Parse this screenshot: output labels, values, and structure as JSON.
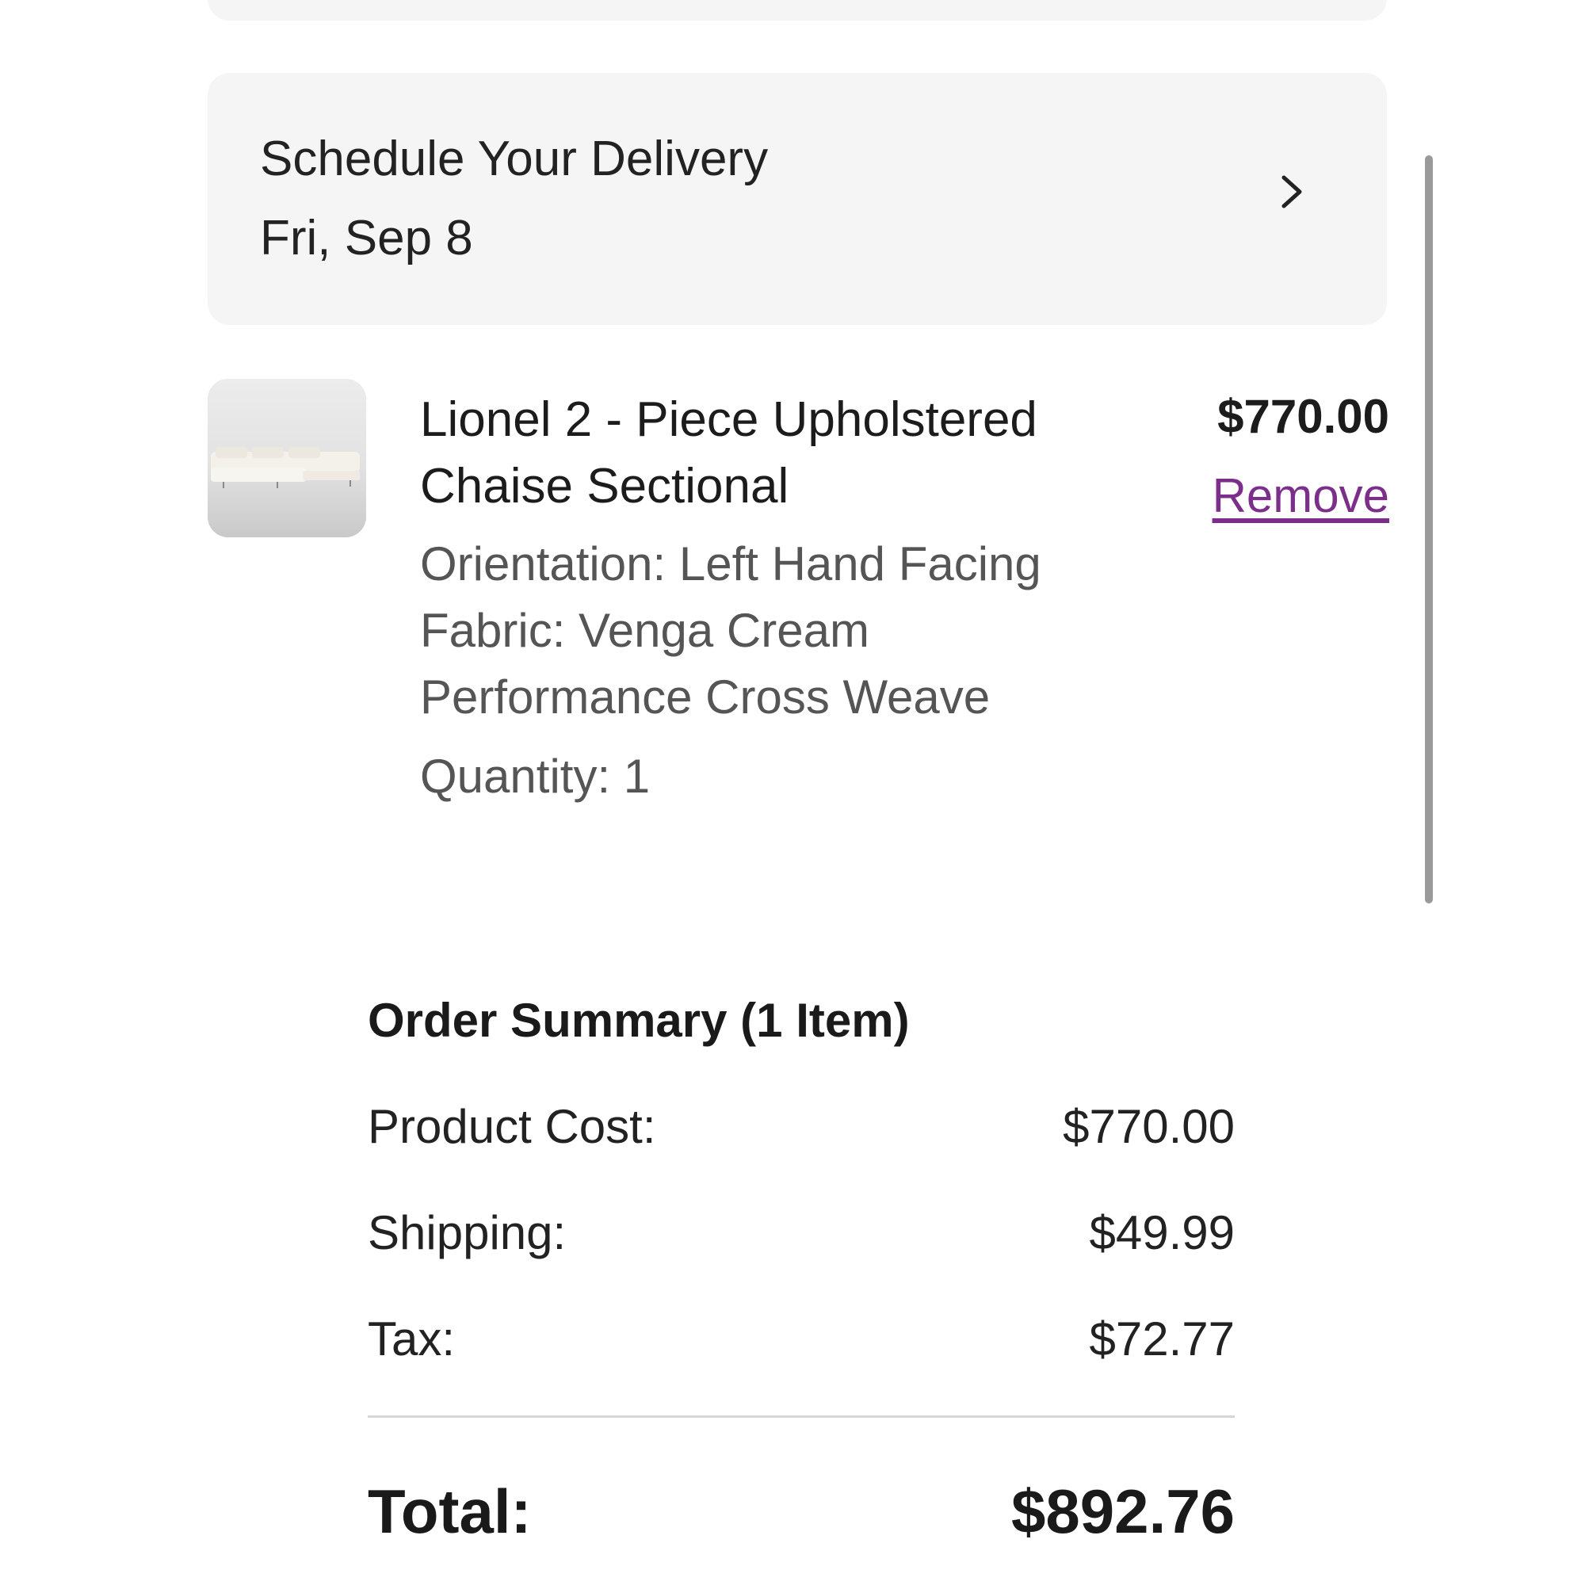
{
  "delivery": {
    "title": "Schedule Your Delivery",
    "date": "Fri, Sep 8",
    "chevron_icon": "chevron-right-icon"
  },
  "product": {
    "image_icon": "sectional-sofa-thumbnail",
    "name": "Lionel 2 - Piece Upholstered Chaise Sectional",
    "price": "$770.00",
    "remove_label": "Remove",
    "orientation": "Orientation: Left Hand Facing",
    "fabric_line1": "Fabric: Venga Cream",
    "fabric_line2": "Performance Cross Weave",
    "quantity": "Quantity: 1"
  },
  "summary": {
    "title": "Order Summary (1 Item)",
    "rows": [
      {
        "label": "Product Cost:",
        "value": "$770.00"
      },
      {
        "label": "Shipping:",
        "value": "$49.99"
      },
      {
        "label": "Tax:",
        "value": "$72.77"
      }
    ],
    "total_label": "Total:",
    "total_value": "$892.76"
  },
  "colors": {
    "card_background": "#f5f5f5",
    "link": "#7b2f8a",
    "text_primary": "#1c1c1c",
    "text_secondary": "#555555",
    "divider": "#d6d6d6"
  }
}
